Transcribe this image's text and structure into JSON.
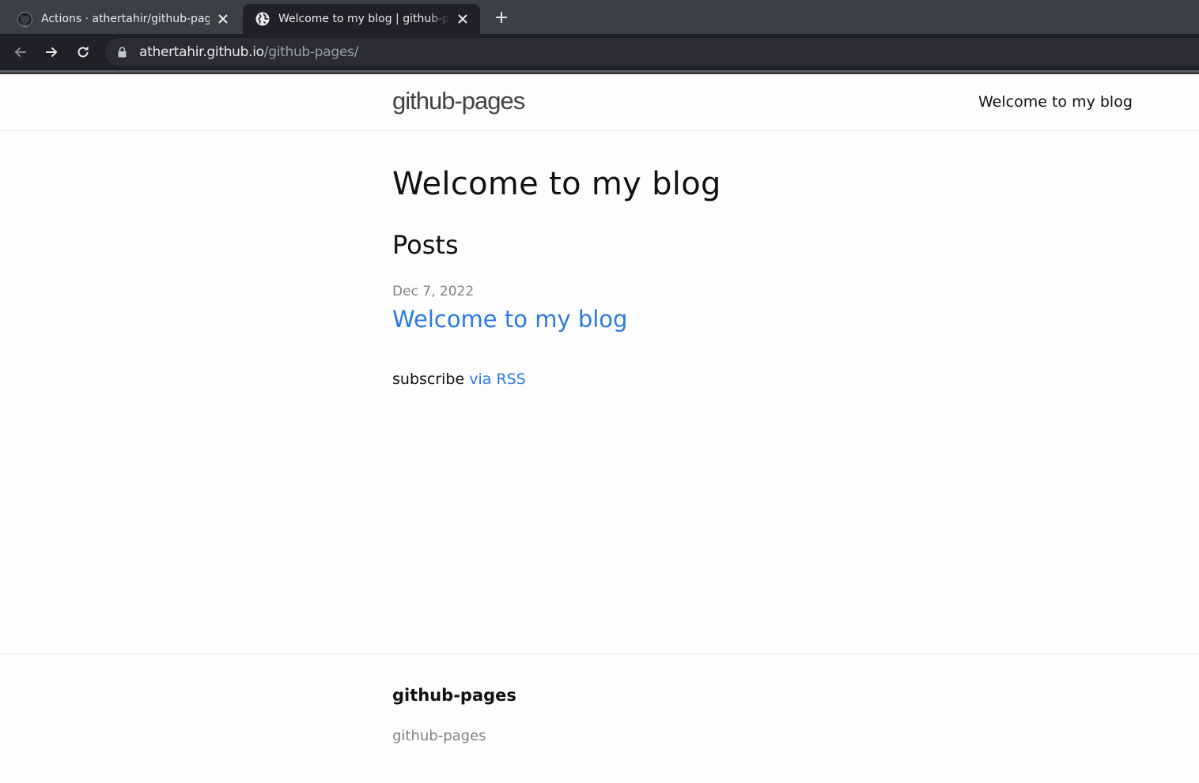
{
  "browser": {
    "tabs": [
      {
        "title": "Actions · athertahir/github-pages",
        "icon": "github-icon",
        "active": false
      },
      {
        "title": "Welcome to my blog | github-pages",
        "icon": "globe-icon",
        "active": true
      }
    ],
    "address": {
      "host": "athertahir.github.io",
      "path": "/github-pages/"
    }
  },
  "header": {
    "site_title": "github-pages",
    "nav": [
      {
        "label": "Welcome to my blog"
      }
    ]
  },
  "main": {
    "page_heading": "Welcome to my blog",
    "posts_heading": "Posts",
    "posts": [
      {
        "date": "Dec 7, 2022",
        "title": "Welcome to my blog"
      }
    ],
    "rss_prefix": "subscribe",
    "rss_link": "via RSS"
  },
  "footer": {
    "heading": "github-pages",
    "name": "github-pages"
  },
  "colors": {
    "link": "#2a7ae2",
    "meta": "#828282",
    "chrome_dark": "#202124",
    "chrome_tabstrip": "#3c3f43"
  }
}
